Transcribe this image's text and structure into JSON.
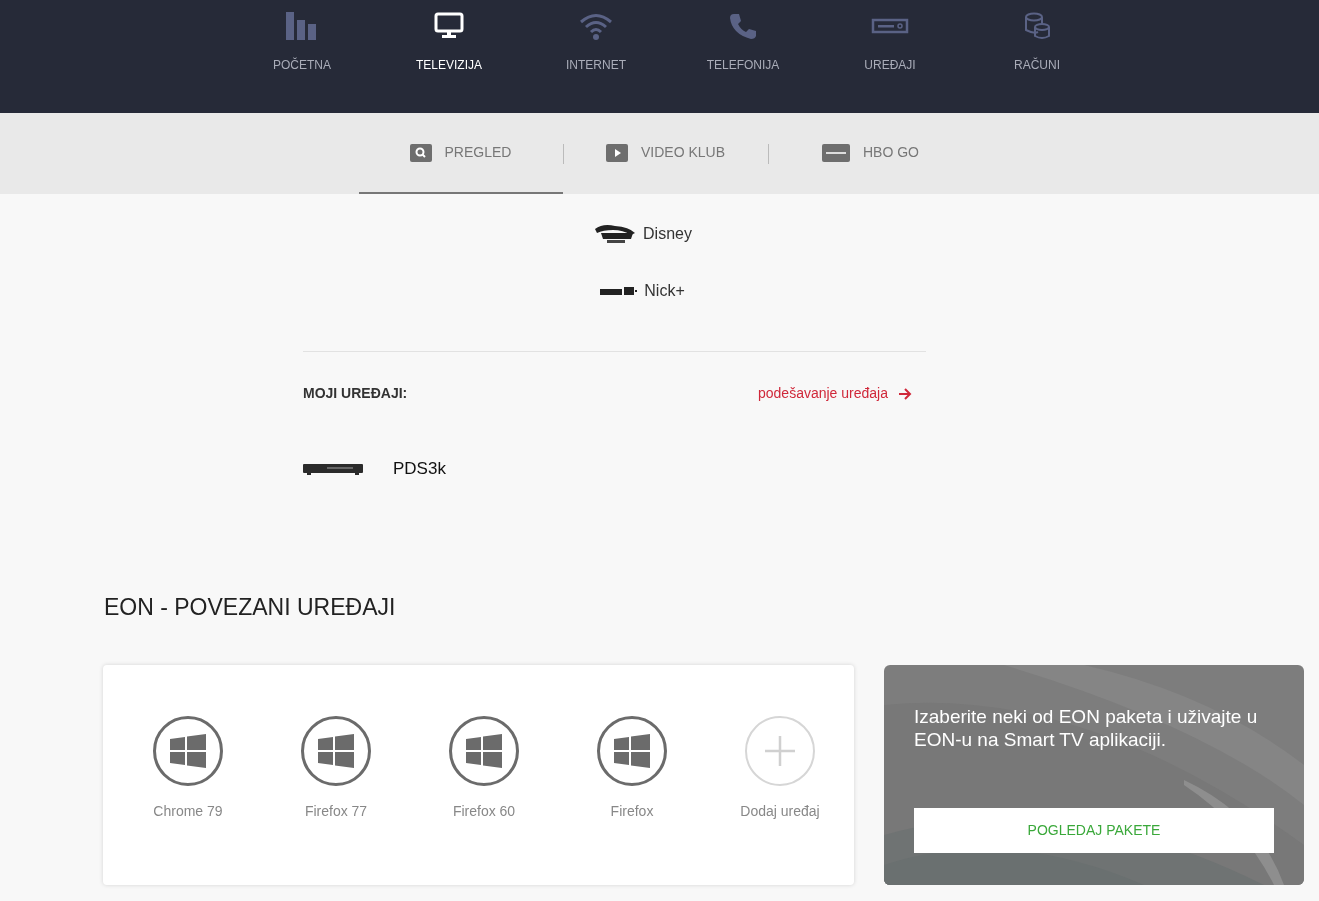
{
  "main_nav": [
    {
      "label": "POČETNA",
      "kind": "home",
      "selected": false
    },
    {
      "label": "TELEVIZIJA",
      "kind": "tv",
      "selected": true
    },
    {
      "label": "INTERNET",
      "kind": "wifi",
      "selected": false
    },
    {
      "label": "TELEFONIJA",
      "kind": "phone",
      "selected": false
    },
    {
      "label": "UREĐAJI",
      "kind": "device",
      "selected": false
    },
    {
      "label": "RAČUNI",
      "kind": "bills",
      "selected": false
    }
  ],
  "sub_tabs": [
    {
      "label": "PREGLED",
      "kind": "search",
      "selected": true
    },
    {
      "label": "VIDEO KLUB",
      "kind": "play",
      "selected": false
    },
    {
      "label": "HBO GO",
      "kind": "hbo",
      "selected": false
    }
  ],
  "channels": [
    {
      "name": "Disney",
      "kind": "disney"
    },
    {
      "name": "Nick+",
      "kind": "nick"
    }
  ],
  "my_devices": {
    "title": "MOJI UREĐAJI:",
    "settings_link": "podešavanje uređaja",
    "devices": [
      {
        "name": "PDS3k"
      }
    ]
  },
  "connected": {
    "title": "EON - POVEZANI UREĐAJI",
    "devices": [
      {
        "name": "Chrome 79",
        "kind": "windows"
      },
      {
        "name": "Firefox 77",
        "kind": "windows"
      },
      {
        "name": "Firefox 60",
        "kind": "windows"
      },
      {
        "name": "Firefox",
        "kind": "windows"
      },
      {
        "name": "Dodaj uređaj",
        "kind": "add"
      }
    ]
  },
  "promo": {
    "text": "Izaberite neki od EON paketa i uživajte u EON-u na Smart TV aplikaciji.",
    "button": "POGLEDAJ PAKETE"
  }
}
